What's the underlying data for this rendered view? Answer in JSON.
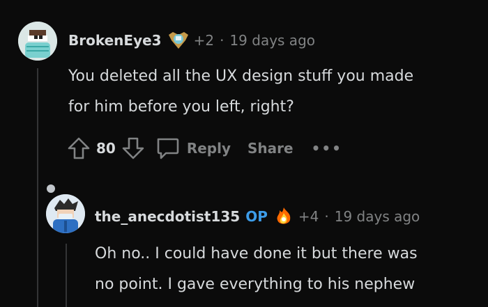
{
  "comment1": {
    "username": "BrokenEye3",
    "award_count": "+2",
    "separator": "·",
    "time": "19 days ago",
    "body_line1": "You deleted all the UX design stuff you made",
    "body_line2": "for him before you left, right?",
    "votes": "80",
    "reply_label": "Reply",
    "share_label": "Share",
    "more_label": "•••",
    "award_icon": "shield-award-icon"
  },
  "comment2": {
    "username": "the_anecdotist135",
    "op_label": "OP",
    "award_count": "+4",
    "separator": "·",
    "time": "19 days ago",
    "body_line1": "Oh no.. I could have done it but there was",
    "body_line2": "no point. I gave everything to his nephew",
    "award_icon": "fire-award-icon"
  },
  "colors": {
    "background": "#0b0b0b",
    "text": "#d7dadc",
    "muted": "#818384",
    "op_blue": "#3d9ce8"
  }
}
